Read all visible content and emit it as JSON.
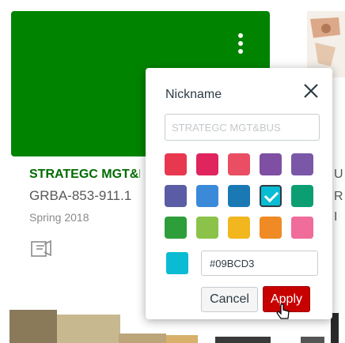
{
  "card": {
    "color": "#008400",
    "title": "STRATEGC MGT&BUS",
    "code": "GRBA-853-911.1",
    "term": "Spring 2018",
    "menu_icon": "kebab-menu-icon",
    "announcements_icon": "announcements-icon"
  },
  "right_card": {
    "fragments": [
      "U",
      "R",
      "I"
    ]
  },
  "popup": {
    "title": "Nickname",
    "close_icon": "close-icon",
    "nickname_placeholder": "STRATEGC MGT&BUS",
    "swatches": [
      {
        "color": "#e8384f",
        "selected": false
      },
      {
        "color": "#e0245e",
        "selected": false
      },
      {
        "color": "#ea4e63",
        "selected": false
      },
      {
        "color": "#7e4fa3",
        "selected": false
      },
      {
        "color": "#7b57a8",
        "selected": false
      },
      {
        "color": "#5a5ca6",
        "selected": false
      },
      {
        "color": "#3b8ad9",
        "selected": false
      },
      {
        "color": "#1a78b5",
        "selected": false
      },
      {
        "color": "#09BCD3",
        "selected": true
      },
      {
        "color": "#0b9e72",
        "selected": false
      },
      {
        "color": "#2e9e3a",
        "selected": false
      },
      {
        "color": "#8bc34a",
        "selected": false
      },
      {
        "color": "#f2b71f",
        "selected": false
      },
      {
        "color": "#f08a24",
        "selected": false
      },
      {
        "color": "#e85a2a",
        "selected": false
      },
      {
        "color": "#f06c9b",
        "selected": false
      }
    ],
    "hex_value": "#09BCD3",
    "cancel_label": "Cancel",
    "apply_label": "Apply"
  }
}
